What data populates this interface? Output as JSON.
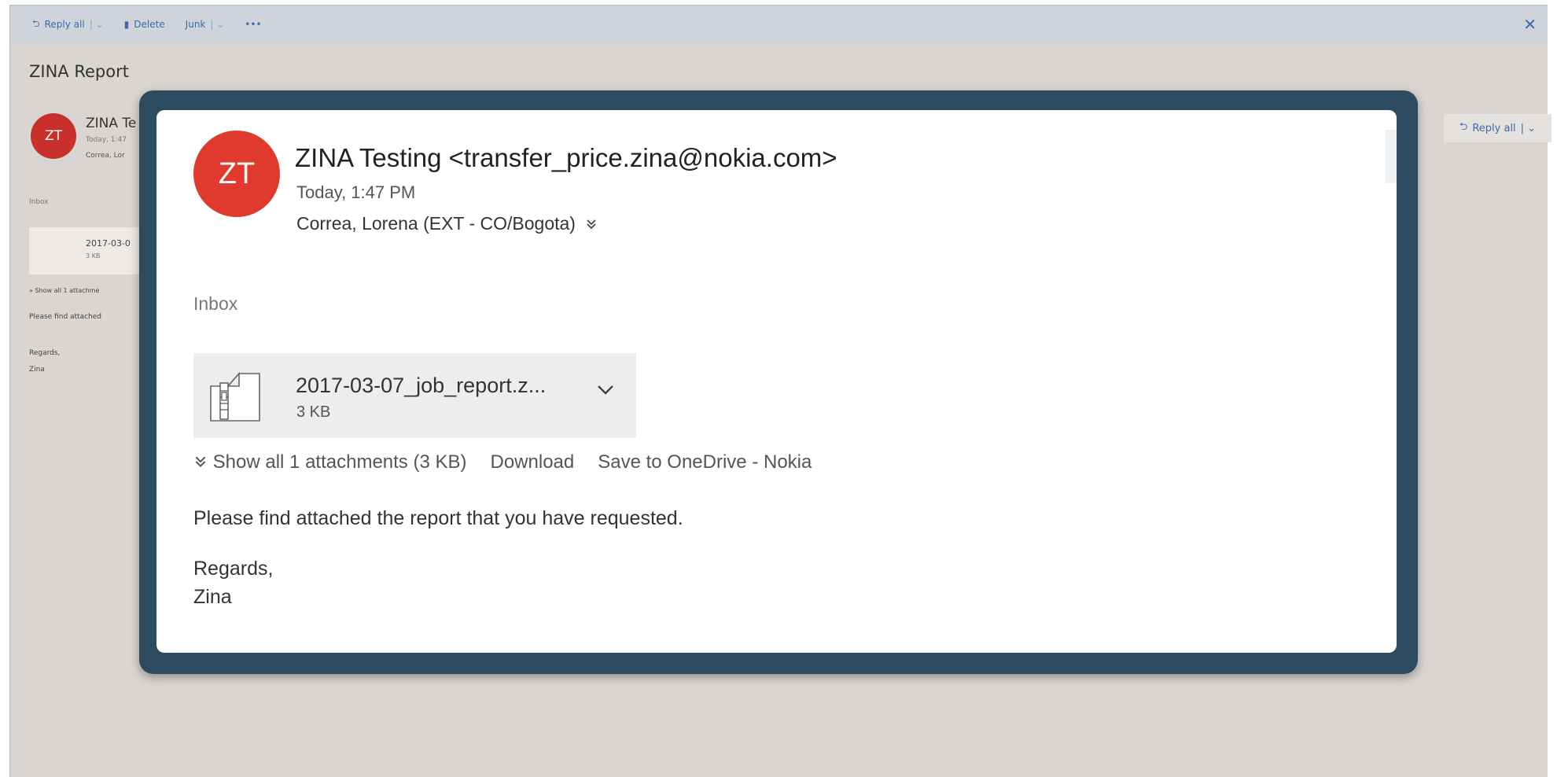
{
  "toolbar": {
    "reply_all": "Reply all",
    "delete": "Delete",
    "junk": "Junk",
    "more": "•••",
    "close": "✕"
  },
  "background": {
    "subject": "ZINA Report",
    "avatar_initials": "ZT",
    "sender_partial": "ZINA Te",
    "date_partial": "Today, 1:47",
    "recipient_partial": "Correa, Lor",
    "folder": "Inbox",
    "attachment_name_partial": "2017-03-0",
    "attachment_size": "3 KB",
    "show_all_partial": "Show all 1 attachme",
    "body_partial": "Please find attached",
    "regards": "Regards,",
    "signature": "Zina",
    "reply_all": "Reply all"
  },
  "message": {
    "avatar_initials": "ZT",
    "sender": "ZINA Testing <transfer_price.zina@nokia.com>",
    "date": "Today, 1:47 PM",
    "recipient": "Correa, Lorena (EXT - CO/Bogota)",
    "folder": "Inbox",
    "attachment": {
      "name": "2017-03-07_job_report.z...",
      "size": "3 KB"
    },
    "actions": {
      "show_all": "Show all 1 attachments (3 KB)",
      "download": "Download",
      "save_onedrive": "Save to OneDrive - Nokia"
    },
    "body": {
      "line1": "Please find attached the report that you have requested.",
      "regards": "Regards,",
      "signature": "Zina"
    }
  },
  "colors": {
    "avatar": "#e03a2e",
    "dialog_frame": "#2e4a5e",
    "toolbar_link": "#3a6ab0"
  }
}
